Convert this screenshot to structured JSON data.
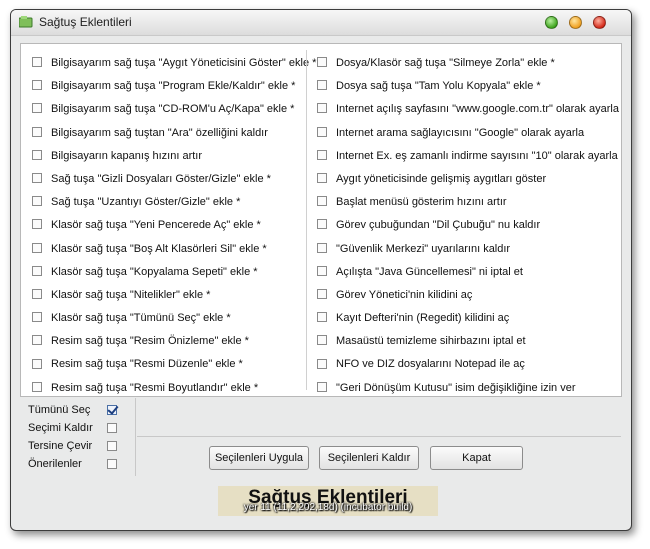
{
  "window": {
    "title": "Sağtuş Eklentileri"
  },
  "left_options": [
    "Bilgisayarım sağ tuşa \"Aygıt Yöneticisini Göster\" ekle *",
    "Bilgisayarım sağ tuşa \"Program Ekle/Kaldır\" ekle *",
    "Bilgisayarım sağ tuşa \"CD-ROM'u Aç/Kapa\" ekle *",
    "Bilgisayarım sağ tuştan \"Ara\" özelliğini kaldır",
    "Bilgisayarın kapanış hızını artır",
    "Sağ tuşa \"Gizli Dosyaları Göster/Gizle\" ekle *",
    "Sağ tuşa \"Uzantıyı Göster/Gizle\" ekle *",
    "Klasör sağ tuşa \"Yeni Pencerede Aç\" ekle *",
    "Klasör sağ tuşa \"Boş Alt Klasörleri Sil\" ekle *",
    "Klasör sağ tuşa \"Kopyalama Sepeti\" ekle *",
    "Klasör sağ tuşa \"Nitelikler\" ekle *",
    "Klasör sağ tuşa \"Tümünü Seç\" ekle *",
    "Resim sağ tuşa \"Resim Önizleme\" ekle *",
    "Resim sağ tuşa \"Resmi Düzenle\" ekle *",
    "Resim sağ tuşa \"Resmi Boyutlandır\" ekle *"
  ],
  "right_options": [
    "Dosya/Klasör sağ tuşa \"Silmeye Zorla\" ekle *",
    "Dosya sağ tuşa \"Tam Yolu Kopyala\" ekle *",
    "Internet açılış sayfasını \"www.google.com.tr\" olarak ayarla",
    "Internet arama sağlayıcısını \"Google\" olarak ayarla",
    "Internet Ex. eş zamanlı indirme sayısını \"10\" olarak ayarla",
    "Aygıt yöneticisinde gelişmiş aygıtları göster",
    "Başlat menüsü gösterim hızını artır",
    "Görev çubuğundan \"Dil Çubuğu\" nu kaldır",
    "\"Güvenlik Merkezi\" uyarılarını kaldır",
    "Açılışta \"Java Güncellemesi\" ni iptal et",
    "Görev Yönetici'nin kilidini aç",
    "Kayıt Defteri'nin (Regedit) kilidini aç",
    "Masaüstü temizleme sihirbazını iptal et",
    "NFO ve DIZ dosyalarını Notepad ile aç",
    "\"Geri Dönüşüm Kutusu\" isim değişikliğine izin ver"
  ],
  "selection": {
    "select_all": "Tümünü Seç",
    "clear_selection": "Seçimi Kaldır",
    "invert": "Tersine Çevir",
    "recommended": "Önerilenler"
  },
  "buttons": {
    "apply": "Seçilenleri Uygula",
    "remove": "Seçilenleri Kaldır",
    "close": "Kapat"
  },
  "banner": {
    "title": "Sağtuş Eklentileri",
    "overlay": "yer 11 (11,2,202,18d) (incubator build)"
  }
}
